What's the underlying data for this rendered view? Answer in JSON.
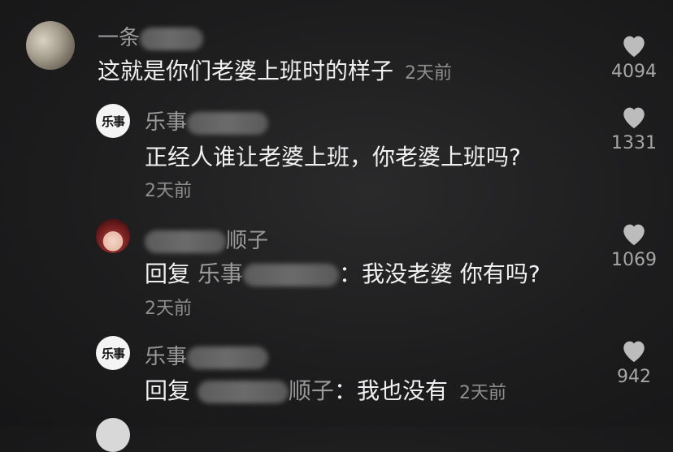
{
  "comments": [
    {
      "username": "一条",
      "text": "这就是你们老婆上班时的样子",
      "time": "2天前",
      "likes": "4094"
    },
    {
      "username": "乐事",
      "text": "正经人谁让老婆上班，你老婆上班吗?",
      "time": "2天前",
      "likes": "1331"
    },
    {
      "username": "顺子",
      "reply_label": "回复",
      "reply_to": "乐事",
      "text": "：我没老婆 你有吗?",
      "time": "2天前",
      "likes": "1069"
    },
    {
      "username": "乐事",
      "reply_label": "回复",
      "reply_to": "顺子",
      "text": "：我也没有",
      "time": "2天前",
      "likes": "942"
    }
  ],
  "icons": {
    "like": "heart-icon"
  },
  "colors": {
    "background": "#1d1d1e",
    "text": "#f0f0f0",
    "muted": "#9a9a9a"
  }
}
